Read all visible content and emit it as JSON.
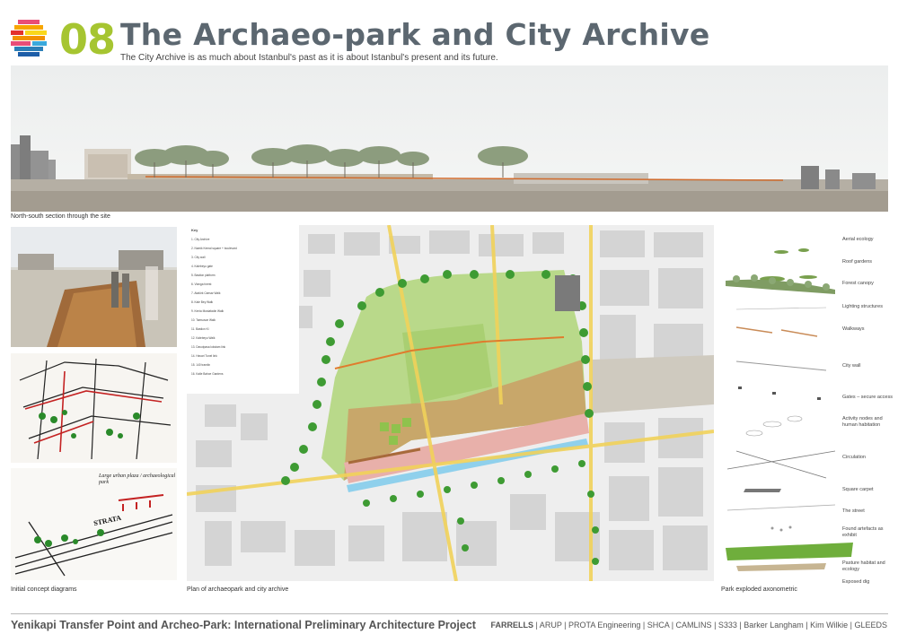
{
  "header": {
    "number": "08",
    "title": "The Archaeo-park and City Archive",
    "subtitle": "The City Archive is as much about Istanbul's past as it is about Istanbul's present and its future."
  },
  "captions": {
    "section": "North-south section through the site",
    "concept": "Initial concept diagrams",
    "plan": "Plan of archaeopark and city archive",
    "axo": "Park exploded axonometric"
  },
  "sketch_note": {
    "upper": "Large urban plaza / archaeological park",
    "lower": "STRATA"
  },
  "key": {
    "title": "Key",
    "items": [
      "1. City Archive",
      "2. Namik Kemal square + boulevard",
      "3. City wall",
      "4. Kalebeyu gate",
      "5. Bastion platform",
      "6. Vlanga forest",
      "7. Atatürk Caesar Walk",
      "8. Kale Bey Walk",
      "9. Kenia Mustafadin Walk",
      "10. Tamsuvar Walk",
      "11. Bastion Ki",
      "12. Kalebeyu Walk",
      "13. Davutpasa lokstam link",
      "14. Havari Tunel link",
      "15. 140 tramlin",
      "16. Kalle Bahce Gardens"
    ]
  },
  "axo_labels": [
    "Aerial ecology",
    "Roof gardens",
    "Forest canopy",
    "Lighting structures",
    "Walkways",
    "City wall",
    "Gates – secure access",
    "Activity nodes and human habitation",
    "Circulation",
    "Square carpet",
    "The street",
    "Found artefacts as exhibit",
    "Pasture habitat and ecology",
    "Exposed dig"
  ],
  "footer": {
    "project": "Yenikapi Transfer Point and Archeo-Park: International Preliminary Architecture Project",
    "lead": "FARRELLS",
    "credits": " | ARUP | PROTA Engineering | SHCA | CAMLINS | S333 | Barker Langham | Kim Wilkie | GLEEDS"
  },
  "colors": {
    "accent_green": "#a6c531",
    "title_grey": "#5c6770"
  }
}
